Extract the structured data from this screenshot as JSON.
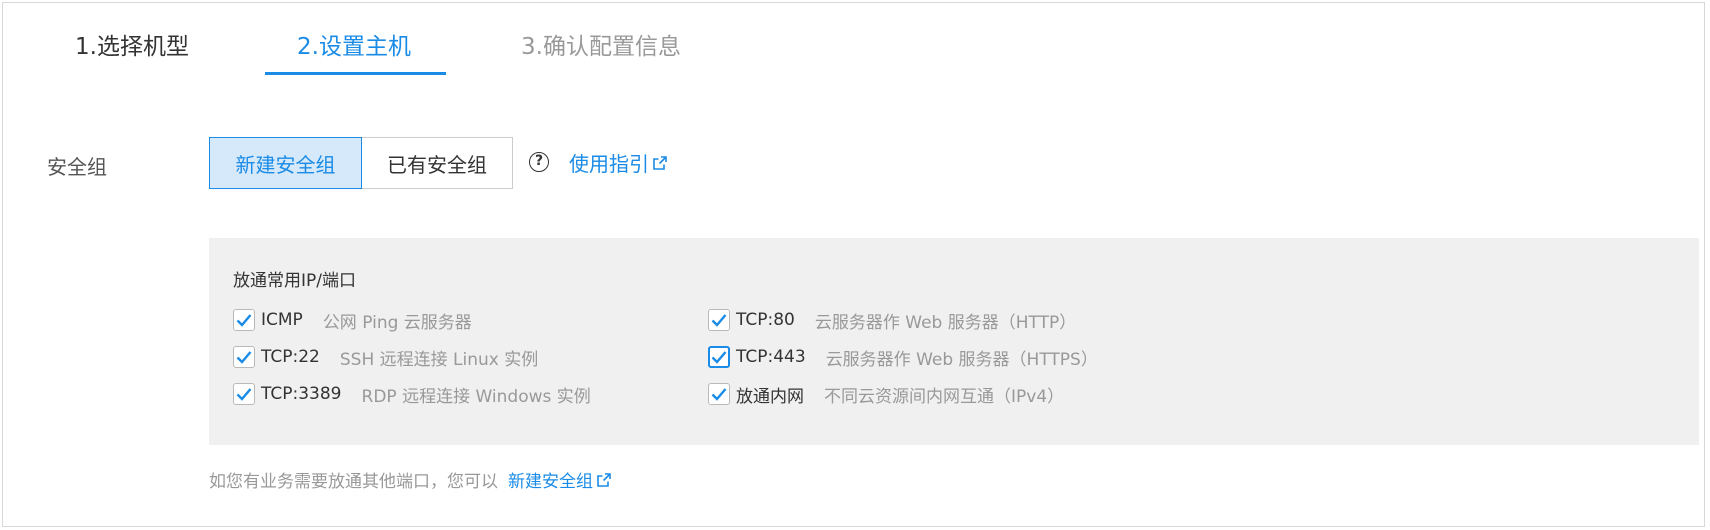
{
  "steps": [
    {
      "label": "1.选择机型"
    },
    {
      "label": "2.设置主机"
    },
    {
      "label": "3.确认配置信息"
    }
  ],
  "active_step": 2,
  "security_group": {
    "label": "安全组",
    "options": [
      "新建安全组",
      "已有安全组"
    ],
    "selected": "新建安全组",
    "guide_link": "使用指引"
  },
  "ports_panel": {
    "title": "放通常用IP/端口",
    "items": [
      {
        "name": "ICMP",
        "desc": "公网 Ping 云服务器",
        "checked": true
      },
      {
        "name": "TCP:22",
        "desc": "SSH 远程连接 Linux 实例",
        "checked": true
      },
      {
        "name": "TCP:3389",
        "desc": "RDP 远程连接 Windows 实例",
        "checked": true
      },
      {
        "name": "TCP:80",
        "desc": "云服务器作 Web 服务器（HTTP）",
        "checked": true
      },
      {
        "name": "TCP:443",
        "desc": "云服务器作 Web 服务器（HTTPS）",
        "checked": true
      },
      {
        "name": "放通内网",
        "desc": "不同云资源间内网互通（IPv4）",
        "checked": true
      }
    ]
  },
  "footer": {
    "note": "如您有业务需要放通其他端口，您可以",
    "link": "新建安全组"
  },
  "colors": {
    "accent": "#1a8be6",
    "panel_bg": "#f0f0f0",
    "muted": "#999999"
  }
}
